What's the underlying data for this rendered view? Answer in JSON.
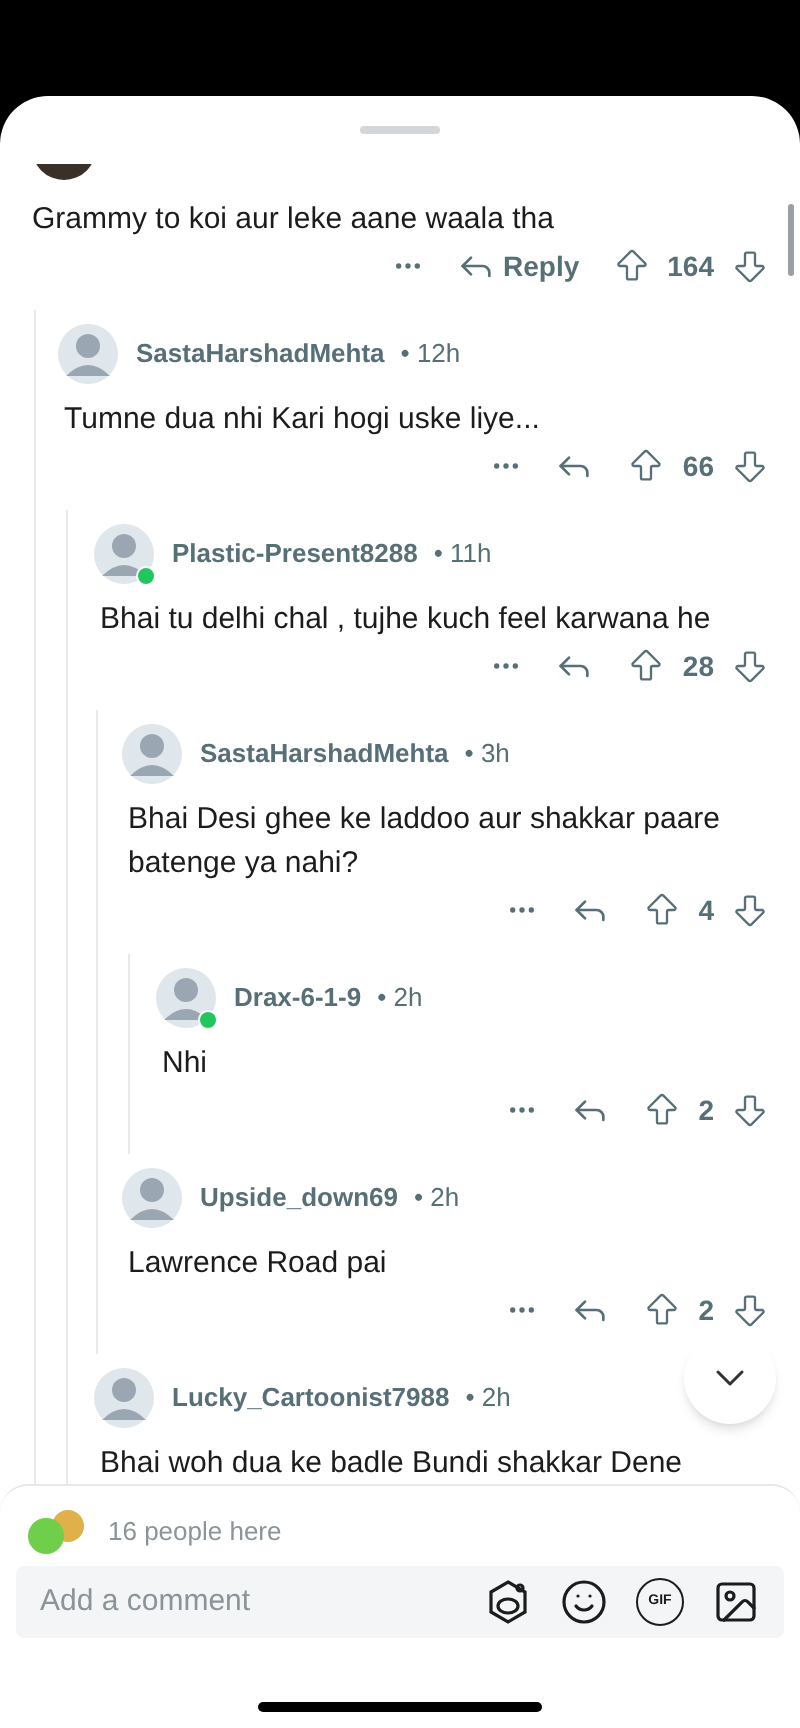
{
  "top_comment": {
    "body": "Grammy to koi aur leke aane waala tha",
    "reply_label": "Reply",
    "score": "164",
    "children": [
      {
        "username": "SastaHarshadMehta",
        "time": "• 12h",
        "online": false,
        "body": "Tumne dua nhi Kari hogi uske liye...",
        "score": "66",
        "children": [
          {
            "username": "Plastic-Present8288",
            "time": "• 11h",
            "online": true,
            "body": "Bhai tu delhi chal , tujhe kuch feel karwana he",
            "score": "28",
            "children": [
              {
                "username": "SastaHarshadMehta",
                "time": "• 3h",
                "online": false,
                "body": "Bhai Desi ghee ke laddoo aur shakkar paare batenge ya nahi?",
                "score": "4",
                "children": [
                  {
                    "username": "Drax-6-1-9",
                    "time": "• 2h",
                    "online": true,
                    "body": "Nhi",
                    "score": "2"
                  }
                ]
              },
              {
                "username": "Upside_down69",
                "time": "• 2h",
                "online": false,
                "body": "Lawrence Road pai",
                "score": "2"
              }
            ]
          },
          {
            "username": "Lucky_Cartoonist7988",
            "time": "• 2h",
            "online": false,
            "body": "Bhai woh dua ke badle Bundi shakkar Dene"
          }
        ]
      }
    ]
  },
  "composer": {
    "presence": "16 people here",
    "placeholder": "Add a comment",
    "gif_label": "GIF"
  }
}
